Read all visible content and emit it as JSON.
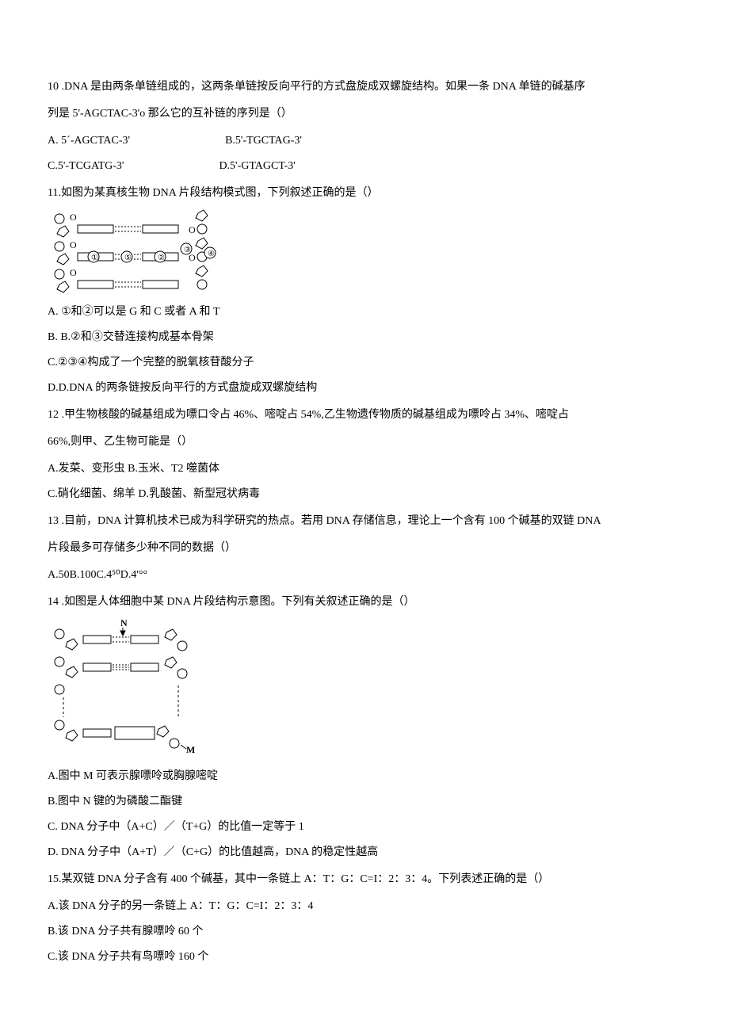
{
  "q10": {
    "stem_l1": "10 .DNA 是由两条单链组成的，这两条单链按反向平行的方式盘旋成双螺旋结构。如果一条 DNA 单链的碱基序",
    "stem_l2": "列是 5'-AGCTAC-3'o 那么它的互补链的序列是（）",
    "optA": "A.  5ˊ-AGCTAC-3'",
    "optB": "B.5'-TGCTAG-3'",
    "optC": "C.5'-TCGATG-3'",
    "optD": "D.5'-GTAGCT-3'"
  },
  "q11": {
    "stem": "11.如图为某真核生物 DNA 片段结构模式图，下列叙述正确的是（）",
    "optA": "A. ①和②可以是 G 和 C 或者 A 和 T",
    "optB": "B. B.②和③交替连接构成基本骨架",
    "optC": "C.②③④构成了一个完整的脱氧核苷酸分子",
    "optD": "D.D.DNA 的两条链按反向平行的方式盘旋成双螺旋结构"
  },
  "q12": {
    "stem_l1": "12 .甲生物核酸的碱基组成为嘌口令占 46%、嘧啶占 54%,乙生物遗传物质的碱基组成为嘌呤占 34%、嘧啶占",
    "stem_l2": "66%,则甲、乙生物可能是（）",
    "optAB": "A.发菜、变形虫 B.玉米、T2 噬菌体",
    "optCD": "C.硝化细菌、绵羊 D.乳酸菌、新型冠状病毒"
  },
  "q13": {
    "stem_l1": "13 .目前，DNA 计算机技术已成为科学研究的热点。若用 DNA 存储信息，理论上一个含有 100 个碱基的双链 DNA",
    "stem_l2": "片段最多可存储多少种不同的数据（）",
    "opts": "A.50B.100C.4⁵⁰D.4'°°"
  },
  "q14": {
    "stem": "14 .如图是人体细胞中某 DNA 片段结构示意图。下列有关叙述正确的是（）",
    "optA": "A.图中 M 可表示腺嘌呤或胸腺嘧啶",
    "optB": "B.图中 N 键的为磷酸二酯键",
    "optC": "C. DNA 分子中（A+C）／（T+G）的比值一定等于 1",
    "optD": "D. DNA 分子中（A+T）／（C+G）的比值越高，DNA 的稳定性越高"
  },
  "q15": {
    "stem": "15.某双链 DNA 分子含有 400 个碱基，其中一条链上 A：T：G：C=I：2：3：4。下列表述正确的是（）",
    "optA": "A.该 DNA 分子的另一条链上 A：T：G：C=I：2：3：4",
    "optB": "B.该 DNA 分子共有腺嘌呤 60 个",
    "optC": "C.该 DNA 分子共有鸟嘌呤 160 个"
  }
}
